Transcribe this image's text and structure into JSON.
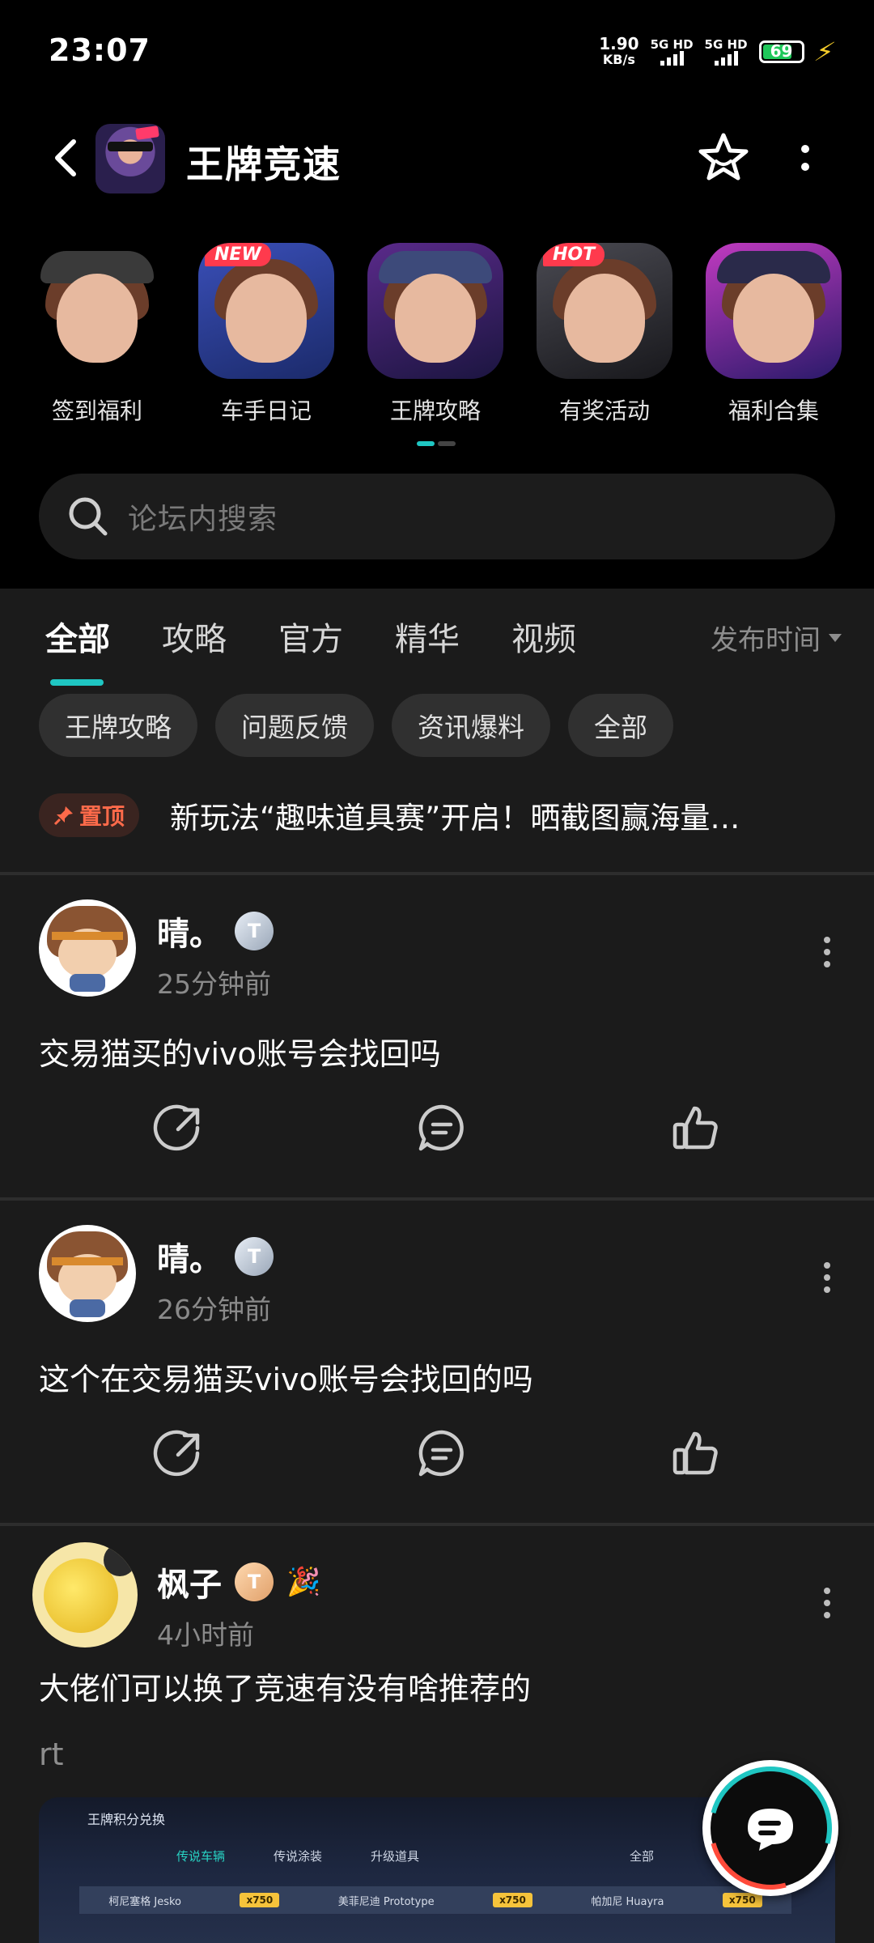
{
  "status_bar": {
    "time": "23:07",
    "net_speed_value": "1.90",
    "net_speed_unit": "KB/s",
    "sim1": "5G HD",
    "sim2": "5G HD",
    "battery": "69"
  },
  "header": {
    "title": "王牌竞速",
    "app_icon": "game-app-icon"
  },
  "shortcuts": [
    {
      "label": "签到福利",
      "badge": ""
    },
    {
      "label": "车手日记",
      "badge": "NEW"
    },
    {
      "label": "王牌攻略",
      "badge": ""
    },
    {
      "label": "有奖活动",
      "badge": "HOT"
    },
    {
      "label": "福利合集",
      "badge": ""
    }
  ],
  "search": {
    "placeholder": "论坛内搜索"
  },
  "tabs": [
    {
      "label": "全部",
      "active": true
    },
    {
      "label": "攻略"
    },
    {
      "label": "官方"
    },
    {
      "label": "精华"
    },
    {
      "label": "视频"
    }
  ],
  "sort_label": "发布时间",
  "chips": [
    "王牌攻略",
    "问题反馈",
    "资讯爆料",
    "全部"
  ],
  "pinned": {
    "badge": "置顶",
    "text": "新玩法“趣味道具赛”开启！晒截图赢海量…"
  },
  "posts": [
    {
      "user": "晴。",
      "level": "T",
      "time": "25分钟前",
      "title": "交易猫买的vivo账号会找回吗"
    },
    {
      "user": "晴。",
      "level": "T",
      "time": "26分钟前",
      "title": "这个在交易猫买vivo账号会找回的吗"
    },
    {
      "user": "枫子",
      "level": "T",
      "time": "4小时前",
      "title": "大佬们可以换了竞速有没有啥推荐的",
      "subtitle": "rt"
    }
  ],
  "screenshot_preview": {
    "heading": "王牌积分兑换",
    "tabs": [
      "传说车辆",
      "传说涂装",
      "升级道具"
    ],
    "filter": "全部",
    "cars": [
      {
        "name": "柯尼塞格 Jesko",
        "price": "x750"
      },
      {
        "name": "美菲尼迪 Prototype",
        "price": "x750"
      },
      {
        "name": "帕加尼 Huayra",
        "price": "x750"
      }
    ]
  },
  "colors": {
    "accent": "#1fc6c2",
    "pin": "#ff6a4a",
    "battery": "#1fc75a",
    "badge_red": "#ff3a4d"
  }
}
